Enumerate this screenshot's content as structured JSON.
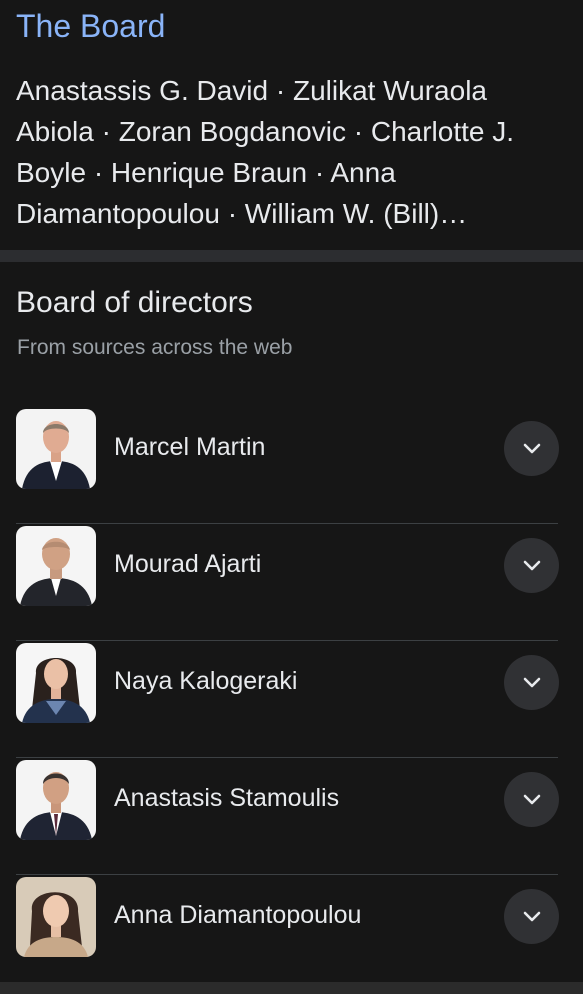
{
  "board": {
    "title": "The Board",
    "members_text": "Anastassis G. David · Zulikat Wuraola Abiola · Zoran Bogdanovic · Charlotte J. Boyle · Henrique Braun · Anna Diamantopoulou · William W. (Bill)…"
  },
  "directors": {
    "title": "Board of directors",
    "subtitle": "From sources across the web",
    "items": [
      {
        "name": "Marcel Martin",
        "icon": "chevron-down-icon"
      },
      {
        "name": "Mourad Ajarti",
        "icon": "chevron-down-icon"
      },
      {
        "name": "Naya Kalogeraki",
        "icon": "chevron-down-icon"
      },
      {
        "name": "Anastasis Stamoulis",
        "icon": "chevron-down-icon"
      },
      {
        "name": "Anna Diamantopoulou",
        "icon": "chevron-down-icon"
      }
    ]
  },
  "colors": {
    "background": "#161616",
    "link": "#8ab4f8",
    "text": "#e8eaed",
    "secondary_text": "#9aa0a6",
    "divider": "#3c4043",
    "button": "#303134"
  }
}
